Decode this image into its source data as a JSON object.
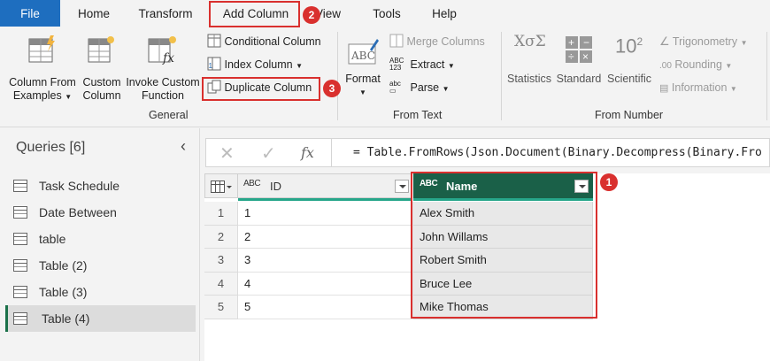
{
  "tabs": [
    "File",
    "Home",
    "Transform",
    "Add Column",
    "View",
    "Tools",
    "Help"
  ],
  "ribbon": {
    "general": {
      "label": "General",
      "column_from_examples": [
        "Column From",
        "Examples"
      ],
      "custom_column": [
        "Custom",
        "Column"
      ],
      "invoke_custom_function": [
        "Invoke Custom",
        "Function"
      ],
      "conditional_column": "Conditional Column",
      "index_column": "Index Column",
      "duplicate_column": "Duplicate Column"
    },
    "from_text": {
      "label": "From Text",
      "format": "Format",
      "merge_columns": "Merge Columns",
      "extract": "Extract",
      "parse": "Parse"
    },
    "from_number": {
      "label": "From Number",
      "statistics": "Statistics",
      "standard": "Standard",
      "scientific": "Scientific",
      "trigonometry": "Trigonometry",
      "rounding": "Rounding",
      "information": "Information"
    }
  },
  "steps": [
    "1",
    "2",
    "3"
  ],
  "queries": {
    "title": "Queries [6]",
    "items": [
      "Task Schedule",
      "Date Between",
      "table",
      "Table (2)",
      "Table (3)",
      "Table (4)"
    ],
    "selected": "Table (4)"
  },
  "formula": {
    "fx": "fx",
    "text": "= Table.FromRows(Json.Document(Binary.Decompress(Binary.Fro"
  },
  "grid": {
    "type_icon": "ABC",
    "columns": [
      "ID",
      "Name"
    ],
    "rows": [
      {
        "num": "1",
        "id": "1",
        "name": "Alex Smith"
      },
      {
        "num": "2",
        "id": "2",
        "name": "John Willams"
      },
      {
        "num": "3",
        "id": "3",
        "name": "Robert Smith"
      },
      {
        "num": "4",
        "id": "4",
        "name": "Bruce Lee"
      },
      {
        "num": "5",
        "id": "5",
        "name": "Mike Thomas"
      }
    ]
  },
  "colors": {
    "file_tab": "#1e6ebf",
    "selected_header": "#1a6048",
    "highlight": "#d9302e",
    "quality_bar": "#26a68a"
  }
}
